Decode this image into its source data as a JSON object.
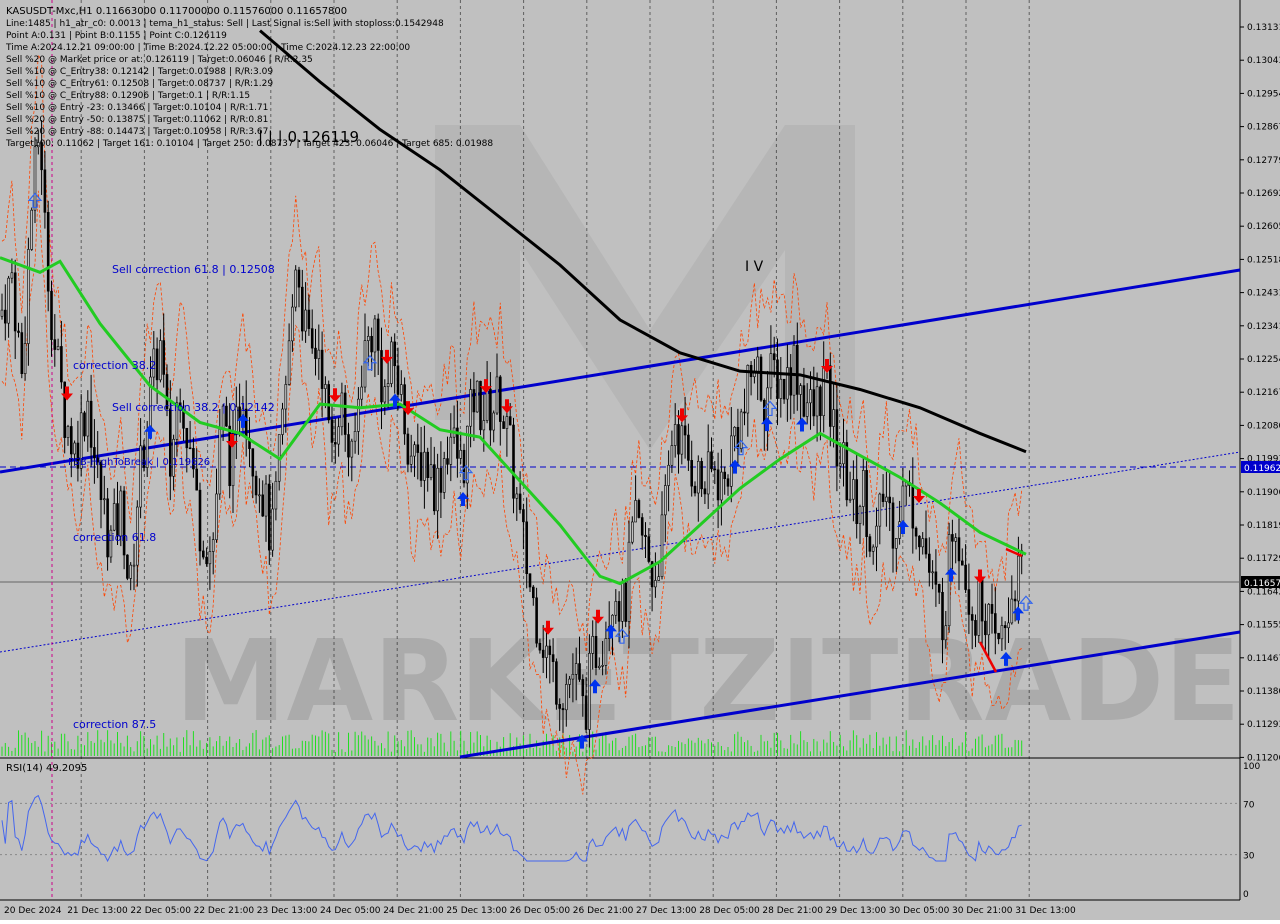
{
  "header": {
    "symbol_line": "KASUSDT-Mxc,H1  0.11663000 0.11700000 0.11576000 0.11657800",
    "info_lines": [
      "Line:1485  |  h1_atr_c0: 0.0013  |  tema_h1_status: Sell  |  Last Signal is:Sell with stoploss:0.1542948",
      "Point A:0.131  |  Point B:0.1155  |  Point C:0.126119",
      "Time A:2024.12.21 09:00:00  |  Time B:2024.12.22 05:00:00  |  Time C:2024.12.23 22:00:00",
      "Sell %20 @ Market price or at: 0.126119  |  Target:0.06046  |  R/R:2.35",
      "Sell %10 @ C_Entry38: 0.12142  |  Target:0.01988  |  R/R:3.09",
      "Sell %10 @ C_Entry61: 0.12508  |  Target:0.08737  |  R/R:1.29",
      "Sell %10 @ C_Entry88: 0.12906  |  Target:0.1  |  R/R:1.15",
      "Sell %10 @ Entry -23: 0.13466  |  Target:0.10104  |  R/R:1.71",
      "Sell %20 @ Entry -50: 0.13875  |  Target:0.11062  |  R/R:0.81",
      "Sell %20 @ Entry -88: 0.14473  |  Target:0.10958  |  R/R:3.67",
      "Target100: 0.11062  |  Target 161: 0.10104  |  Target 250: 0.08737  |  Target 423: 0.06046  |  Target 685: 0.01988"
    ]
  },
  "annotations": {
    "point_c_label": "| | | 0.126119",
    "wave_label": "I V",
    "sell_correction_618": "Sell correction 61.8 | 0.12508",
    "correction_382": "correction 38.2",
    "sell_correction_382": "Sell correction 38.2 | 0.12142",
    "fsb_label": "FSB-HighToBreak | 0.119626",
    "correction_618": "correction 61.8",
    "correction_875": "correction 87.5",
    "watermark": "MARKETZITRADE"
  },
  "price_axis": {
    "ticks": [
      "0.13131",
      "0.13043",
      "0.12954",
      "0.12867",
      "0.12779",
      "0.12692",
      "0.12605",
      "0.12518",
      "0.12431",
      "0.12341",
      "0.12254",
      "0.12167",
      "0.12080",
      "0.11993",
      "0.11906",
      "0.11819",
      "0.11729",
      "0.11642",
      "0.11555",
      "0.11467",
      "0.11380",
      "0.11293",
      "0.11206"
    ],
    "current_price_tag": "0.11657",
    "fsb_price_tag": "0.11962"
  },
  "time_axis": {
    "labels": [
      "20 Dec 2024",
      "21 Dec 13:00",
      "22 Dec 05:00",
      "22 Dec 21:00",
      "23 Dec 13:00",
      "24 Dec 05:00",
      "24 Dec 21:00",
      "25 Dec 13:00",
      "26 Dec 05:00",
      "26 Dec 21:00",
      "27 Dec 13:00",
      "28 Dec 05:00",
      "28 Dec 21:00",
      "29 Dec 13:00",
      "30 Dec 05:00",
      "30 Dec 21:00",
      "31 Dec 13:00"
    ]
  },
  "rsi_panel": {
    "label": "RSI(14) 49.2095",
    "ticks": [
      "100",
      "70",
      "30",
      "0"
    ]
  },
  "colors": {
    "background": "#c0c0c0",
    "candle": "#000000",
    "ma_fast": "#22cc22",
    "ma_slow": "#000000",
    "channel": "#0000cc",
    "fib_text": "#0000cc",
    "envelope": "#ff4400",
    "rsi": "#4466ee",
    "buy_arrow": "#0033ee",
    "sell_arrow": "#ee0000",
    "volume": "#22dd22"
  },
  "chart_data": {
    "type": "candlestick",
    "symbol": "KASUSDT-Mxc",
    "timeframe": "H1",
    "ohlc_last": {
      "open": 0.11663,
      "high": 0.117,
      "low": 0.11576,
      "close": 0.116578
    },
    "ylim": [
      0.1118,
      0.1322
    ],
    "price_path_points": [
      [
        0,
        0.1237
      ],
      [
        12,
        0.1248
      ],
      [
        22,
        0.122
      ],
      [
        30,
        0.1262
      ],
      [
        40,
        0.129
      ],
      [
        46,
        0.1255
      ],
      [
        55,
        0.1228
      ],
      [
        65,
        0.121
      ],
      [
        75,
        0.12
      ],
      [
        88,
        0.1215
      ],
      [
        96,
        0.1195
      ],
      [
        110,
        0.1175
      ],
      [
        122,
        0.1185
      ],
      [
        130,
        0.116
      ],
      [
        138,
        0.119
      ],
      [
        150,
        0.1215
      ],
      [
        160,
        0.123
      ],
      [
        170,
        0.1195
      ],
      [
        180,
        0.122
      ],
      [
        190,
        0.12
      ],
      [
        200,
        0.118
      ],
      [
        212,
        0.1172
      ],
      [
        222,
        0.121
      ],
      [
        232,
        0.1195
      ],
      [
        242,
        0.122
      ],
      [
        252,
        0.12
      ],
      [
        262,
        0.119
      ],
      [
        272,
        0.1175
      ],
      [
        280,
        0.12
      ],
      [
        290,
        0.123
      ],
      [
        296,
        0.1255
      ],
      [
        302,
        0.124
      ],
      [
        310,
        0.1225
      ],
      [
        320,
        0.123
      ],
      [
        330,
        0.12
      ],
      [
        340,
        0.1215
      ],
      [
        352,
        0.1195
      ],
      [
        362,
        0.1225
      ],
      [
        374,
        0.1235
      ],
      [
        384,
        0.1215
      ],
      [
        394,
        0.1225
      ],
      [
        404,
        0.121
      ],
      [
        414,
        0.1195
      ],
      [
        424,
        0.12
      ],
      [
        436,
        0.119
      ],
      [
        450,
        0.1205
      ],
      [
        462,
        0.1195
      ],
      [
        474,
        0.1215
      ],
      [
        486,
        0.121
      ],
      [
        500,
        0.1215
      ],
      [
        510,
        0.12
      ],
      [
        520,
        0.118
      ],
      [
        532,
        0.116
      ],
      [
        542,
        0.115
      ],
      [
        552,
        0.114
      ],
      [
        562,
        0.1135
      ],
      [
        574,
        0.114
      ],
      [
        584,
        0.1128
      ],
      [
        594,
        0.1145
      ],
      [
        604,
        0.115
      ],
      [
        614,
        0.1165
      ],
      [
        624,
        0.1155
      ],
      [
        634,
        0.118
      ],
      [
        644,
        0.1175
      ],
      [
        654,
        0.1165
      ],
      [
        664,
        0.118
      ],
      [
        674,
        0.121
      ],
      [
        684,
        0.12
      ],
      [
        694,
        0.1195
      ],
      [
        704,
        0.119
      ],
      [
        714,
        0.1195
      ],
      [
        724,
        0.119
      ],
      [
        734,
        0.1205
      ],
      [
        744,
        0.121
      ],
      [
        754,
        0.1225
      ],
      [
        764,
        0.1215
      ],
      [
        774,
        0.1222
      ],
      [
        784,
        0.1218
      ],
      [
        794,
        0.1225
      ],
      [
        804,
        0.1215
      ],
      [
        814,
        0.121
      ],
      [
        824,
        0.122
      ],
      [
        834,
        0.1205
      ],
      [
        844,
        0.1195
      ],
      [
        854,
        0.1185
      ],
      [
        864,
        0.119
      ],
      [
        874,
        0.117
      ],
      [
        884,
        0.119
      ],
      [
        894,
        0.118
      ],
      [
        904,
        0.119
      ],
      [
        914,
        0.1185
      ],
      [
        924,
        0.1175
      ],
      [
        934,
        0.116
      ],
      [
        944,
        0.1155
      ],
      [
        954,
        0.1185
      ],
      [
        964,
        0.117
      ],
      [
        974,
        0.1155
      ],
      [
        984,
        0.116
      ],
      [
        994,
        0.1145
      ],
      [
        1004,
        0.115
      ],
      [
        1014,
        0.1165
      ],
      [
        1024,
        0.1166
      ]
    ],
    "ma_fast_points": [
      [
        0,
        0.1253
      ],
      [
        40,
        0.1249
      ],
      [
        60,
        0.1252
      ],
      [
        100,
        0.1235
      ],
      [
        150,
        0.1218
      ],
      [
        200,
        0.1208
      ],
      [
        240,
        0.1205
      ],
      [
        280,
        0.1198
      ],
      [
        320,
        0.1213
      ],
      [
        360,
        0.1212
      ],
      [
        400,
        0.1213
      ],
      [
        440,
        0.1206
      ],
      [
        480,
        0.1204
      ],
      [
        520,
        0.1192
      ],
      [
        560,
        0.118
      ],
      [
        600,
        0.1166
      ],
      [
        620,
        0.1164
      ],
      [
        660,
        0.117
      ],
      [
        700,
        0.118
      ],
      [
        740,
        0.119
      ],
      [
        780,
        0.1198
      ],
      [
        820,
        0.1205
      ],
      [
        860,
        0.1199
      ],
      [
        900,
        0.1193
      ],
      [
        940,
        0.1186
      ],
      [
        980,
        0.1178
      ],
      [
        1026,
        0.1172
      ]
    ],
    "ma_slow_points": [
      [
        260,
        0.1315
      ],
      [
        320,
        0.1301
      ],
      [
        380,
        0.1288
      ],
      [
        440,
        0.1277
      ],
      [
        500,
        0.1264
      ],
      [
        560,
        0.1251
      ],
      [
        620,
        0.1236
      ],
      [
        680,
        0.1227
      ],
      [
        740,
        0.1222
      ],
      [
        800,
        0.1221
      ],
      [
        860,
        0.1217
      ],
      [
        920,
        0.1212
      ],
      [
        980,
        0.1205
      ],
      [
        1026,
        0.12
      ]
    ],
    "levels": [
      {
        "name": "FSB-HighToBreak",
        "price": 0.119626
      }
    ],
    "rsi_last": 49.2095,
    "rsi_ylim": [
      0,
      100
    ]
  }
}
